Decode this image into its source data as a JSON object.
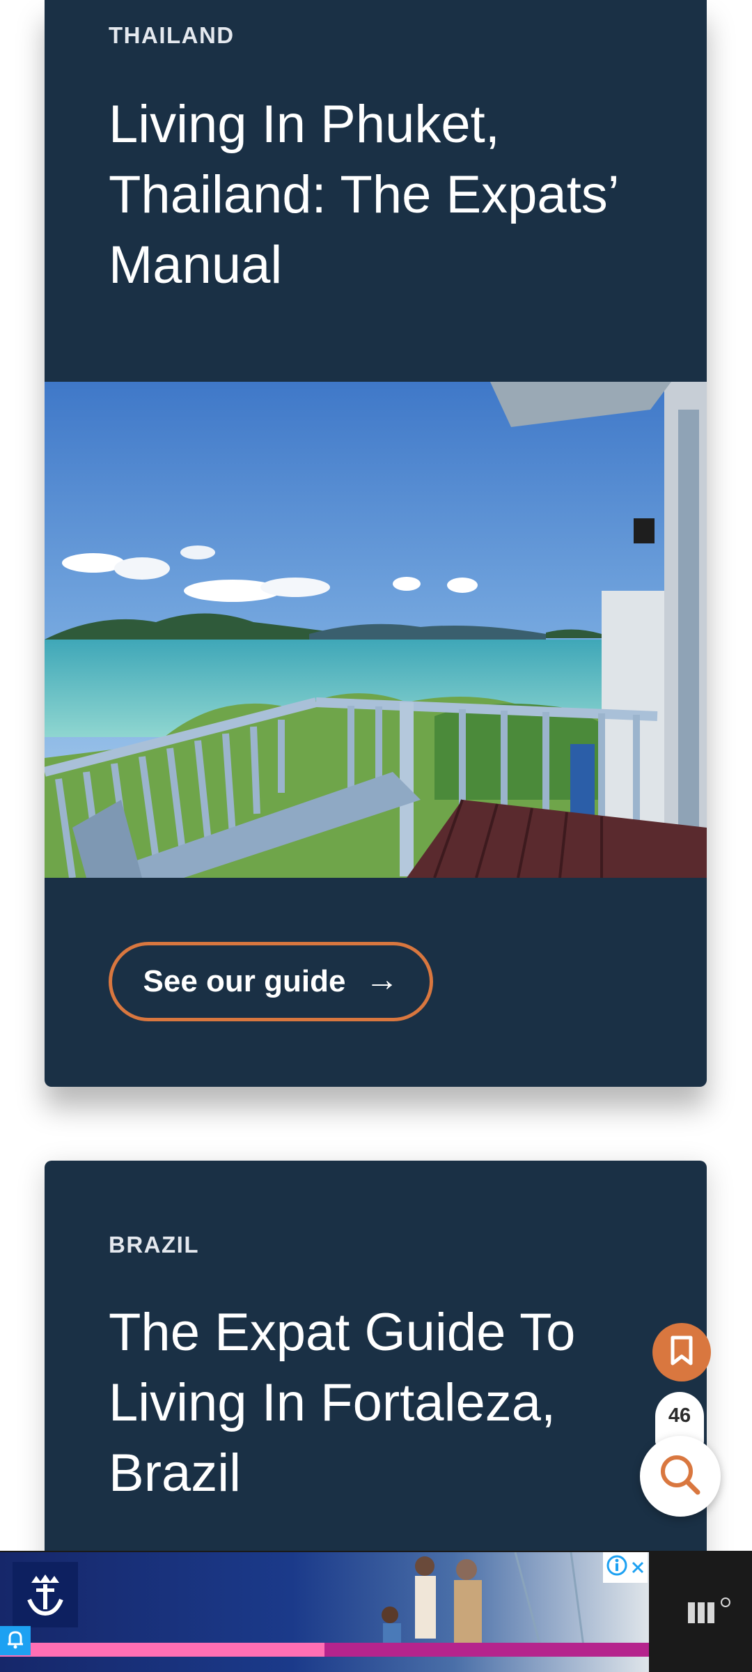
{
  "cards": [
    {
      "country": "THAILAND",
      "title": "Living In Phuket, Thailand: The Expats’ Manual",
      "cta_label": "See our guide",
      "cta_arrow": "→",
      "image_alt": "Phuket balcony sea view"
    },
    {
      "country": "BRAZIL",
      "title": "The Expat Guide To Living In Fortaleza, Brazil"
    }
  ],
  "floating": {
    "bookmark_icon": "bookmark-icon",
    "count": "46",
    "search_icon": "search-icon"
  },
  "ad": {
    "brand_icon": "anchor-crown-icon",
    "info_icon": "info-icon",
    "close_icon": "close-icon",
    "bell_icon": "bell-icon"
  },
  "colors": {
    "card_bg": "#1a3045",
    "accent": "#d9773f"
  }
}
